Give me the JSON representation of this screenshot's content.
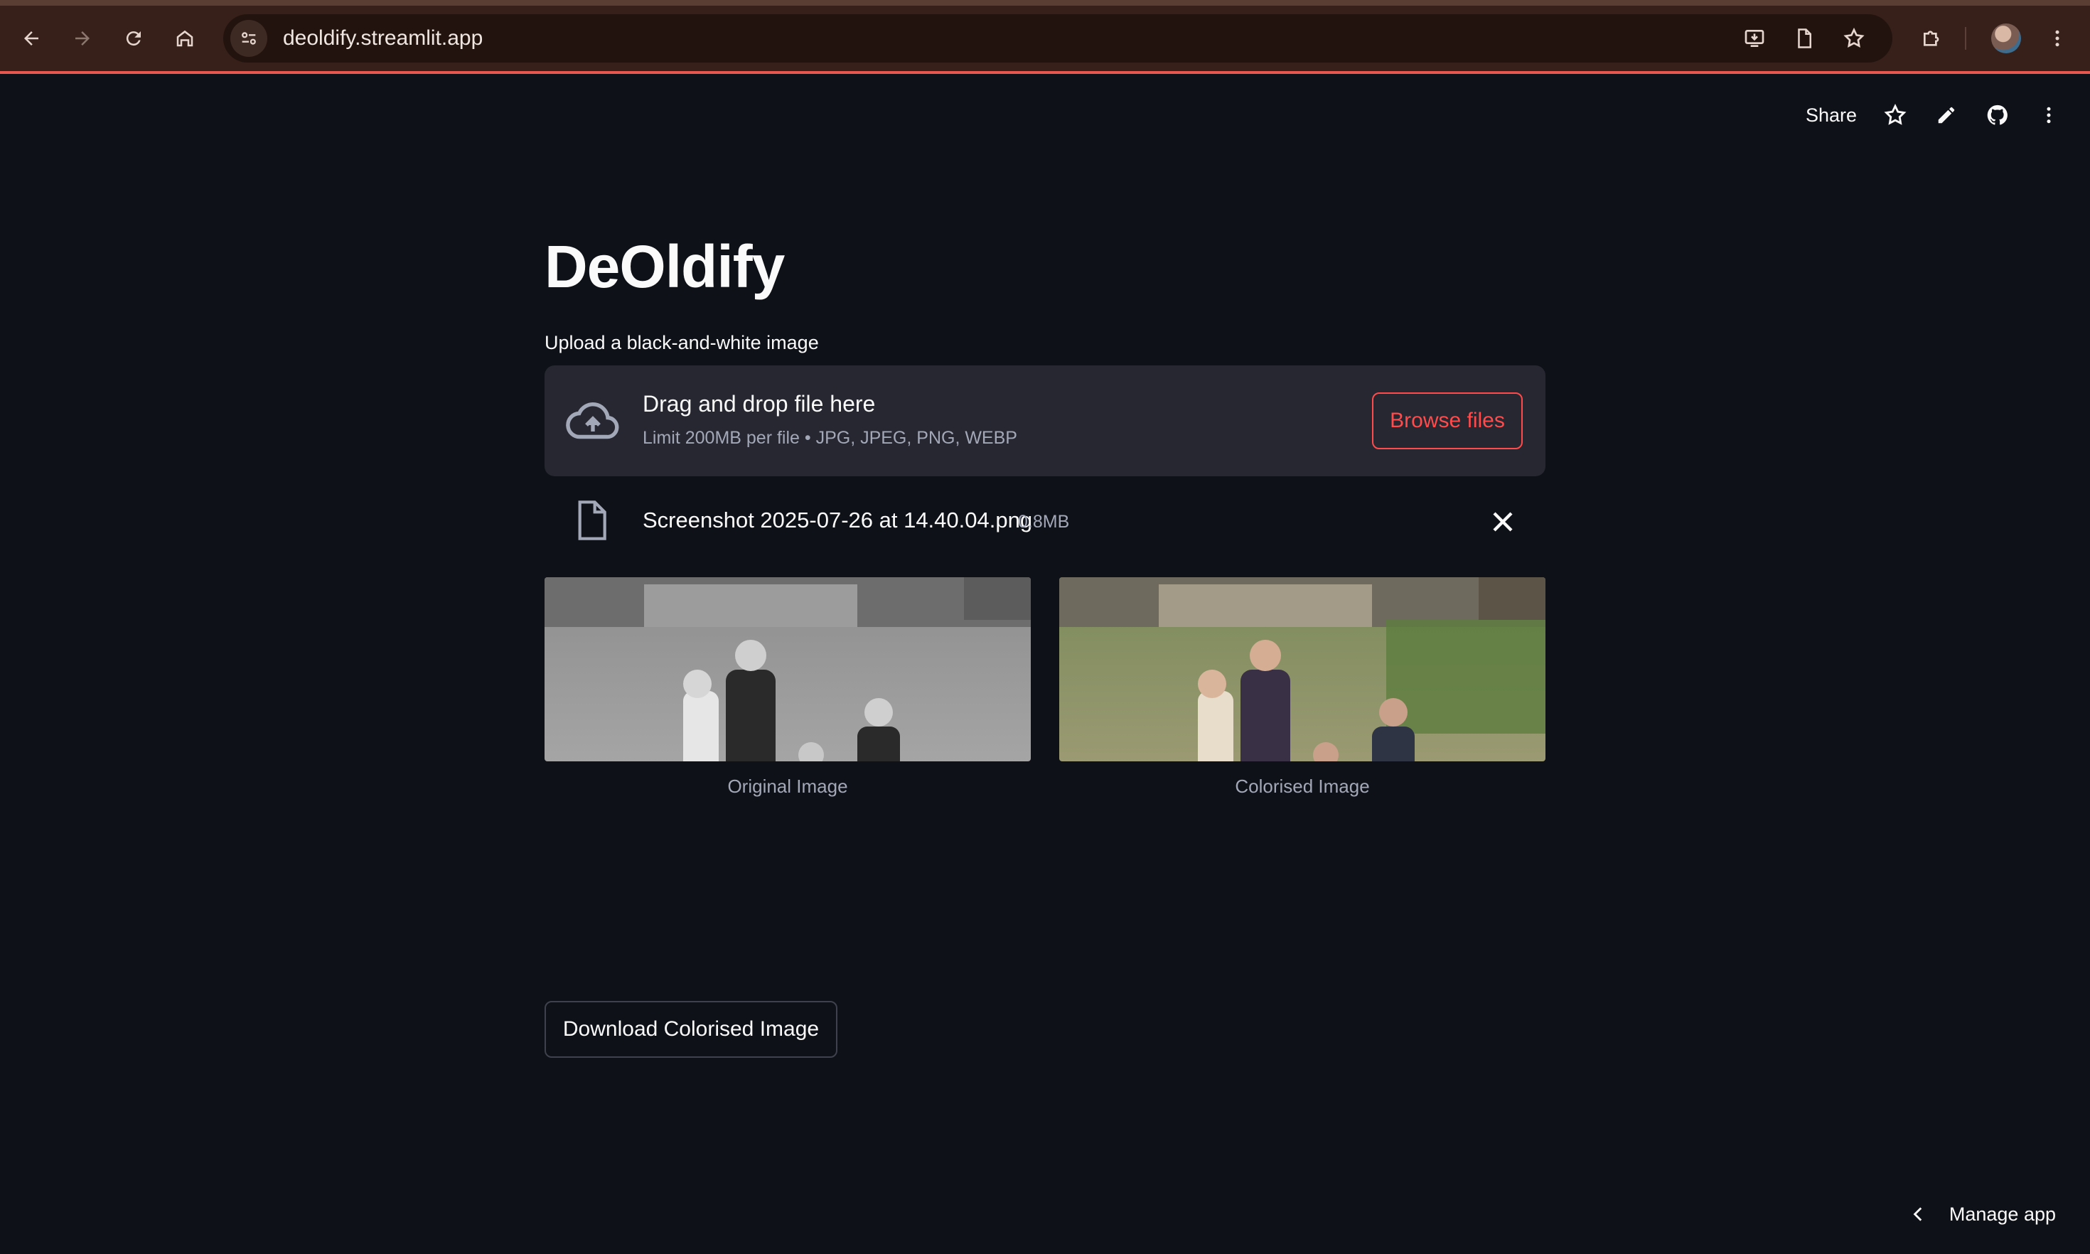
{
  "browser": {
    "url": "deoldify.streamlit.app"
  },
  "toolbar": {
    "share_label": "Share"
  },
  "page": {
    "title": "DeOldify",
    "upload_label": "Upload a black-and-white image"
  },
  "uploader": {
    "drag_text": "Drag and drop file here",
    "limit_text": "Limit 200MB per file • JPG, JPEG, PNG, WEBP",
    "browse_label": "Browse files"
  },
  "file": {
    "name": "Screenshot 2025-07-26 at 14.40.04.png",
    "size": "0.8MB"
  },
  "images": {
    "original_caption": "Original Image",
    "colorised_caption": "Colorised Image"
  },
  "actions": {
    "download_label": "Download Colorised Image",
    "manage_app_label": "Manage app"
  },
  "colors": {
    "accent": "#ff4b4b",
    "background": "#0e1117",
    "dropzone": "#262730",
    "browser_bar": "#362019"
  }
}
